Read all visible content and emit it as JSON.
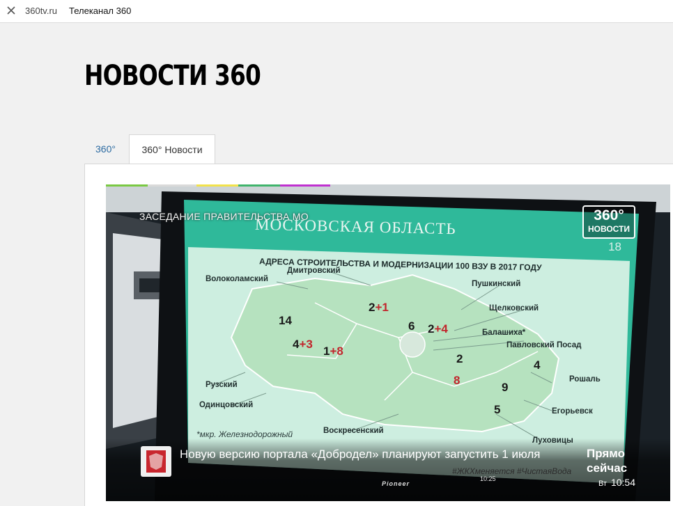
{
  "browser": {
    "domain": "360tv.ru",
    "title": "Телеканал 360",
    "close_icon": "close-icon"
  },
  "site": {
    "logo": "НОВОСТИ 360"
  },
  "tabs": [
    {
      "label": "360°",
      "active": false
    },
    {
      "label": "360° Новости",
      "active": true
    }
  ],
  "video": {
    "session_caption": "ЗАСЕДАНИЕ ПРАВИТЕЛЬСТВА МО",
    "brand_top": "360°",
    "brand_bottom": "НОВОСТИ",
    "slide": {
      "region_title": "МОСКОВСКАЯ ОБЛАСТЬ",
      "page_number": "18",
      "caption": "АДРЕСА СТРОИТЕЛЬСТВА И МОДЕРНИЗАЦИИ 100 ВЗУ В 2017 ГОДУ",
      "districts": [
        "Волоколамский",
        "Дмитровский",
        "Пушкинский",
        "Щелковский",
        "Балашиха*",
        "Павловский Посад",
        "Рошаль",
        "Егорьевск",
        "Луховицы",
        "Воскресенский",
        "Одинцовский",
        "Рузский"
      ],
      "numbers": {
        "volokolamsk": "14",
        "ruza_a": "4",
        "ruza_b": "+3",
        "odin_a": "1",
        "odin_b": "+8",
        "dmitrov_a": "2",
        "dmitrov_b": "+1",
        "pushkino": "6",
        "schelkovo_a": "2",
        "schelkovo_b": "+4",
        "balashiha": "2",
        "pavlov": "4",
        "mid": "8",
        "voskr": "9",
        "egor": "5"
      },
      "footnote": "*мкр. Железнодорожный",
      "hashtags": "#ЖКХменяется #ЧистаяВода"
    },
    "news_ticker": "Новую версию портала «Добродел» планируют запустить 1 июля",
    "monitor_brand": "Pioneer",
    "video_time": "10:25",
    "live_label": "Прямо сейчас",
    "day": "Вт",
    "time": "10:54",
    "colors": {
      "slide_green": "#2fb99a",
      "map_green": "#bfe8c5",
      "red_numbers": "#c2252c"
    }
  }
}
